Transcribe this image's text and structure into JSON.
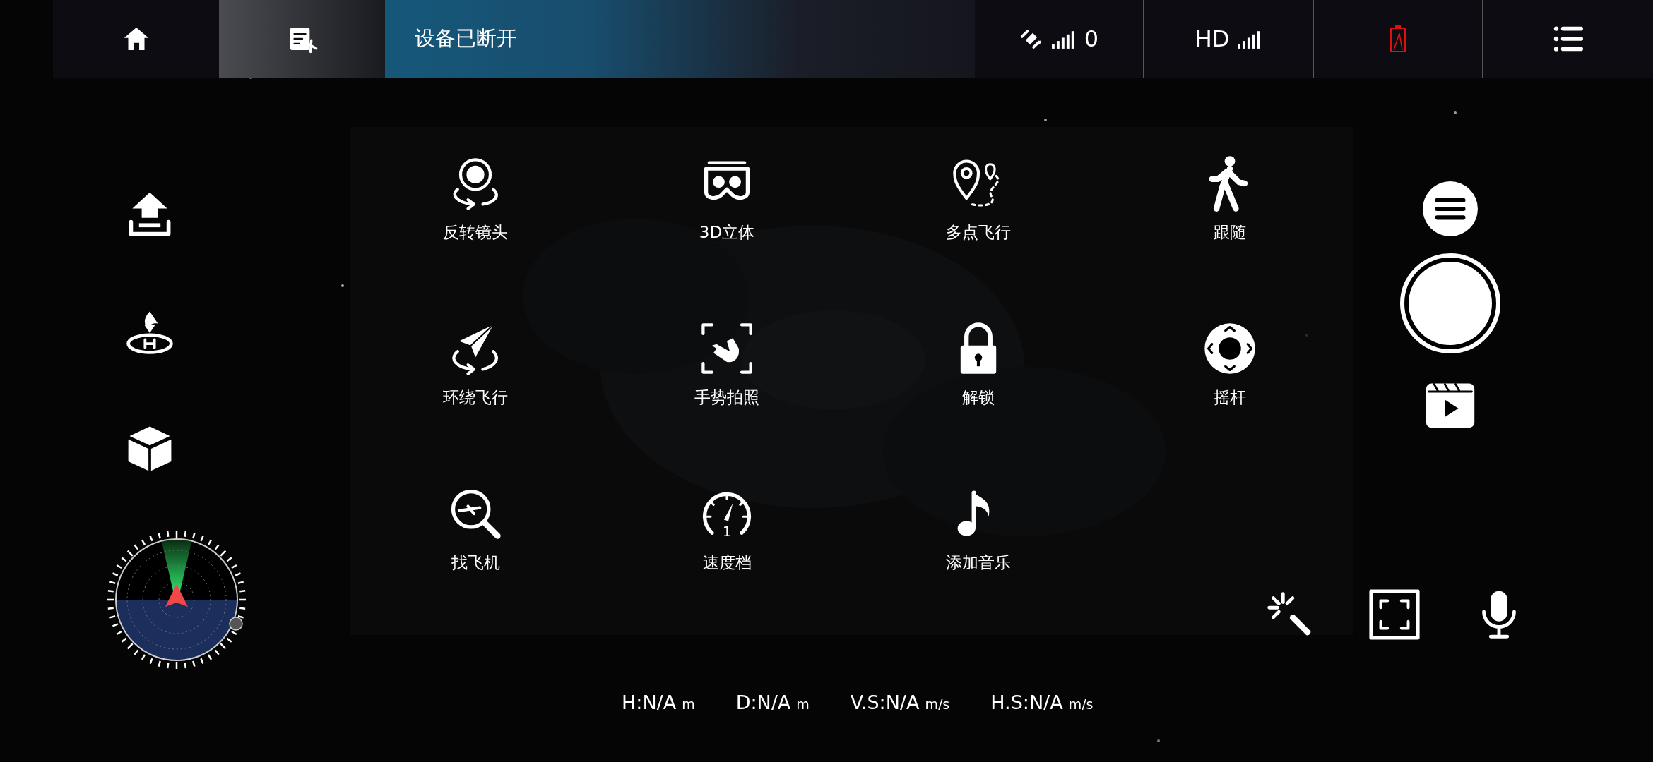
{
  "top_bar": {
    "tabs": [
      {
        "kind": "home",
        "selected": false
      },
      {
        "kind": "log",
        "selected": true
      }
    ],
    "status": "设备已断开",
    "satellites": "0",
    "video_link": "HD",
    "battery": {
      "low": true
    }
  },
  "menu": [
    {
      "kind": "flip-lens",
      "label": "反转镜头"
    },
    {
      "kind": "vr",
      "label": "3D立体"
    },
    {
      "kind": "waypoints",
      "label": "多点飞行"
    },
    {
      "kind": "follow",
      "label": "跟随"
    },
    {
      "kind": "orbit",
      "label": "环绕飞行"
    },
    {
      "kind": "gesture",
      "label": "手势拍照"
    },
    {
      "kind": "lock",
      "label": "解锁"
    },
    {
      "kind": "joystick",
      "label": "摇杆"
    },
    {
      "kind": "find",
      "label": "找飞机"
    },
    {
      "kind": "speed",
      "label": "速度档",
      "icon_text": "1"
    },
    {
      "kind": "music",
      "label": "添加音乐"
    }
  ],
  "telemetry": [
    {
      "value": "H:N/A",
      "unit": "m"
    },
    {
      "value": "D:N/A",
      "unit": "m"
    },
    {
      "value": "V.S:N/A",
      "unit": "m/s"
    },
    {
      "value": "H.S:N/A",
      "unit": "m/s"
    }
  ]
}
